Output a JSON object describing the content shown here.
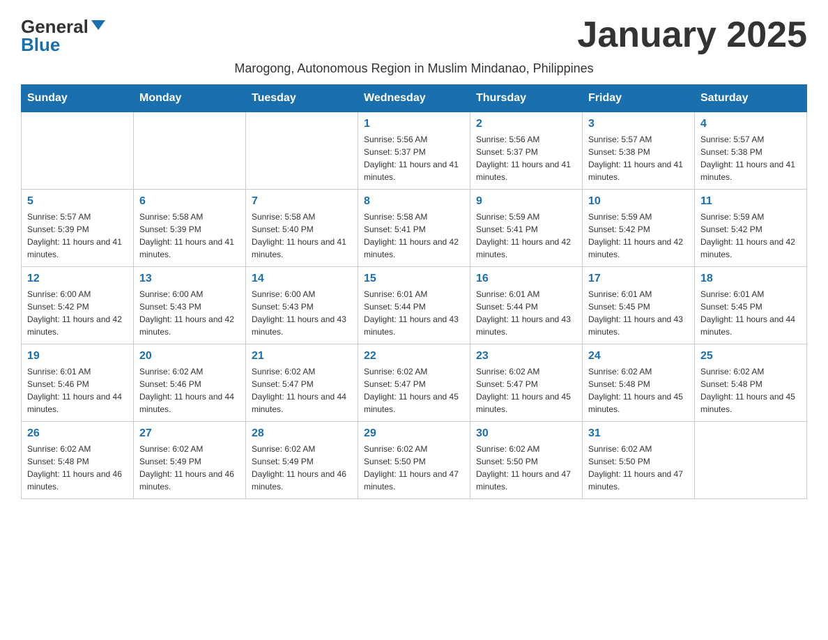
{
  "header": {
    "logo_general": "General",
    "logo_blue": "Blue",
    "month_title": "January 2025",
    "subtitle": "Marogong, Autonomous Region in Muslim Mindanao, Philippines"
  },
  "days_of_week": [
    "Sunday",
    "Monday",
    "Tuesday",
    "Wednesday",
    "Thursday",
    "Friday",
    "Saturday"
  ],
  "weeks": [
    [
      {
        "day": "",
        "info": ""
      },
      {
        "day": "",
        "info": ""
      },
      {
        "day": "",
        "info": ""
      },
      {
        "day": "1",
        "info": "Sunrise: 5:56 AM\nSunset: 5:37 PM\nDaylight: 11 hours and 41 minutes."
      },
      {
        "day": "2",
        "info": "Sunrise: 5:56 AM\nSunset: 5:37 PM\nDaylight: 11 hours and 41 minutes."
      },
      {
        "day": "3",
        "info": "Sunrise: 5:57 AM\nSunset: 5:38 PM\nDaylight: 11 hours and 41 minutes."
      },
      {
        "day": "4",
        "info": "Sunrise: 5:57 AM\nSunset: 5:38 PM\nDaylight: 11 hours and 41 minutes."
      }
    ],
    [
      {
        "day": "5",
        "info": "Sunrise: 5:57 AM\nSunset: 5:39 PM\nDaylight: 11 hours and 41 minutes."
      },
      {
        "day": "6",
        "info": "Sunrise: 5:58 AM\nSunset: 5:39 PM\nDaylight: 11 hours and 41 minutes."
      },
      {
        "day": "7",
        "info": "Sunrise: 5:58 AM\nSunset: 5:40 PM\nDaylight: 11 hours and 41 minutes."
      },
      {
        "day": "8",
        "info": "Sunrise: 5:58 AM\nSunset: 5:41 PM\nDaylight: 11 hours and 42 minutes."
      },
      {
        "day": "9",
        "info": "Sunrise: 5:59 AM\nSunset: 5:41 PM\nDaylight: 11 hours and 42 minutes."
      },
      {
        "day": "10",
        "info": "Sunrise: 5:59 AM\nSunset: 5:42 PM\nDaylight: 11 hours and 42 minutes."
      },
      {
        "day": "11",
        "info": "Sunrise: 5:59 AM\nSunset: 5:42 PM\nDaylight: 11 hours and 42 minutes."
      }
    ],
    [
      {
        "day": "12",
        "info": "Sunrise: 6:00 AM\nSunset: 5:42 PM\nDaylight: 11 hours and 42 minutes."
      },
      {
        "day": "13",
        "info": "Sunrise: 6:00 AM\nSunset: 5:43 PM\nDaylight: 11 hours and 42 minutes."
      },
      {
        "day": "14",
        "info": "Sunrise: 6:00 AM\nSunset: 5:43 PM\nDaylight: 11 hours and 43 minutes."
      },
      {
        "day": "15",
        "info": "Sunrise: 6:01 AM\nSunset: 5:44 PM\nDaylight: 11 hours and 43 minutes."
      },
      {
        "day": "16",
        "info": "Sunrise: 6:01 AM\nSunset: 5:44 PM\nDaylight: 11 hours and 43 minutes."
      },
      {
        "day": "17",
        "info": "Sunrise: 6:01 AM\nSunset: 5:45 PM\nDaylight: 11 hours and 43 minutes."
      },
      {
        "day": "18",
        "info": "Sunrise: 6:01 AM\nSunset: 5:45 PM\nDaylight: 11 hours and 44 minutes."
      }
    ],
    [
      {
        "day": "19",
        "info": "Sunrise: 6:01 AM\nSunset: 5:46 PM\nDaylight: 11 hours and 44 minutes."
      },
      {
        "day": "20",
        "info": "Sunrise: 6:02 AM\nSunset: 5:46 PM\nDaylight: 11 hours and 44 minutes."
      },
      {
        "day": "21",
        "info": "Sunrise: 6:02 AM\nSunset: 5:47 PM\nDaylight: 11 hours and 44 minutes."
      },
      {
        "day": "22",
        "info": "Sunrise: 6:02 AM\nSunset: 5:47 PM\nDaylight: 11 hours and 45 minutes."
      },
      {
        "day": "23",
        "info": "Sunrise: 6:02 AM\nSunset: 5:47 PM\nDaylight: 11 hours and 45 minutes."
      },
      {
        "day": "24",
        "info": "Sunrise: 6:02 AM\nSunset: 5:48 PM\nDaylight: 11 hours and 45 minutes."
      },
      {
        "day": "25",
        "info": "Sunrise: 6:02 AM\nSunset: 5:48 PM\nDaylight: 11 hours and 45 minutes."
      }
    ],
    [
      {
        "day": "26",
        "info": "Sunrise: 6:02 AM\nSunset: 5:48 PM\nDaylight: 11 hours and 46 minutes."
      },
      {
        "day": "27",
        "info": "Sunrise: 6:02 AM\nSunset: 5:49 PM\nDaylight: 11 hours and 46 minutes."
      },
      {
        "day": "28",
        "info": "Sunrise: 6:02 AM\nSunset: 5:49 PM\nDaylight: 11 hours and 46 minutes."
      },
      {
        "day": "29",
        "info": "Sunrise: 6:02 AM\nSunset: 5:50 PM\nDaylight: 11 hours and 47 minutes."
      },
      {
        "day": "30",
        "info": "Sunrise: 6:02 AM\nSunset: 5:50 PM\nDaylight: 11 hours and 47 minutes."
      },
      {
        "day": "31",
        "info": "Sunrise: 6:02 AM\nSunset: 5:50 PM\nDaylight: 11 hours and 47 minutes."
      },
      {
        "day": "",
        "info": ""
      }
    ]
  ]
}
